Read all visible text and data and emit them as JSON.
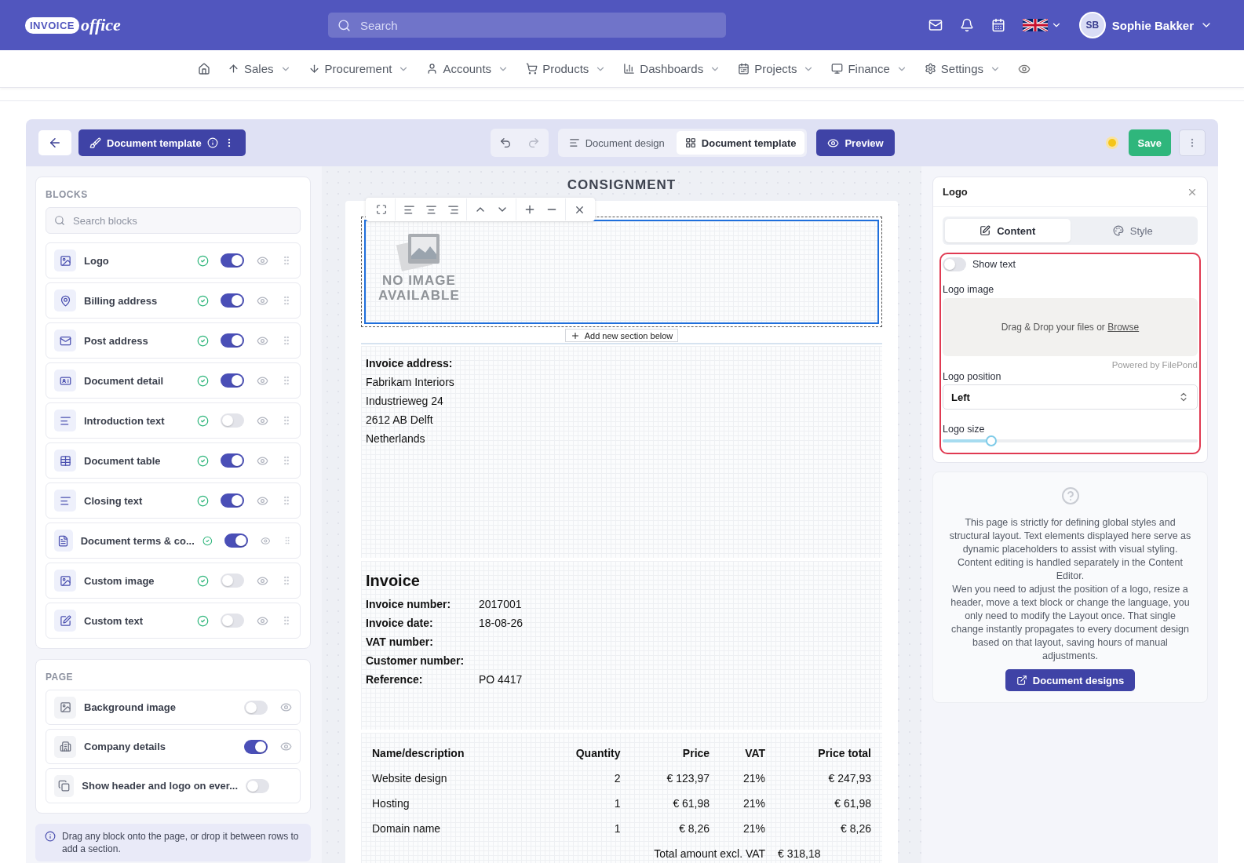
{
  "logo": {
    "word": "INVOICE",
    "script": "office"
  },
  "search": {
    "placeholder": "Search"
  },
  "user": {
    "initials": "SB",
    "name": "Sophie Bakker"
  },
  "nav": [
    {
      "label": "Sales"
    },
    {
      "label": "Procurement"
    },
    {
      "label": "Accounts"
    },
    {
      "label": "Products"
    },
    {
      "label": "Dashboards"
    },
    {
      "label": "Projects"
    },
    {
      "label": "Finance"
    },
    {
      "label": "Settings"
    }
  ],
  "editor_toolbar": {
    "template_button": "Document template",
    "views": [
      {
        "label": "Document design",
        "selected": false
      },
      {
        "label": "Document template",
        "selected": true
      }
    ],
    "preview": "Preview",
    "save": "Save"
  },
  "blocks": {
    "title": "BLOCKS",
    "search_placeholder": "Search blocks",
    "items": [
      {
        "label": "Logo",
        "on": true
      },
      {
        "label": "Billing address",
        "on": true
      },
      {
        "label": "Post address",
        "on": true
      },
      {
        "label": "Document detail",
        "on": true
      },
      {
        "label": "Introduction text",
        "on": false
      },
      {
        "label": "Document table",
        "on": true
      },
      {
        "label": "Closing text",
        "on": true
      },
      {
        "label": "Document terms & co...",
        "on": true
      },
      {
        "label": "Custom image",
        "on": false
      },
      {
        "label": "Custom text",
        "on": false
      }
    ]
  },
  "page": {
    "title": "PAGE",
    "items": [
      {
        "label": "Background image",
        "on": false,
        "eye": true
      },
      {
        "label": "Company details",
        "on": true,
        "eye": true
      },
      {
        "label": "Show header and logo on ever...",
        "on": false,
        "eye": false
      }
    ]
  },
  "hint": "Drag any block onto the page, or drop it between rows to add a section.",
  "document": {
    "title": "CONSIGNMENT",
    "logo_placeholder": [
      "NO IMAGE",
      "AVAILABLE"
    ],
    "add_section": "Add new section below",
    "address_title": "Invoice address:",
    "address": [
      "Fabrikam Interiors",
      "Industrieweg 24",
      "2612 AB Delft",
      "Netherlands"
    ],
    "heading": "Invoice",
    "details": [
      {
        "label": "Invoice number:",
        "value": "2017001"
      },
      {
        "label": "Invoice date:",
        "value": "18-08-26"
      },
      {
        "label": "VAT number:"
      },
      {
        "label": "Customer number:"
      },
      {
        "label": "Reference:",
        "value": "PO 4417"
      }
    ],
    "table": {
      "columns": [
        "Name/description",
        "Quantity",
        "Price",
        "VAT",
        "Price total"
      ],
      "rows": [
        [
          "Website design",
          "2",
          "€ 123,97",
          "21%",
          "€ 247,93"
        ],
        [
          "Hosting",
          "1",
          "€ 61,98",
          "21%",
          "€ 61,98"
        ],
        [
          "Domain name",
          "1",
          "€ 8,26",
          "21%",
          "€ 8,26"
        ]
      ],
      "total_label": "Total amount excl. VAT",
      "total_value": "€ 318,18"
    }
  },
  "inspector": {
    "title": "Logo",
    "tabs": [
      {
        "label": "Content",
        "selected": true
      },
      {
        "label": "Style",
        "selected": false
      }
    ],
    "show_text": {
      "label": "Show text",
      "on": false
    },
    "image_label": "Logo image",
    "drop_text": "Drag & Drop your files or ",
    "browse": "Browse",
    "powered": "Powered by FilePond",
    "position_label": "Logo position",
    "position_value": "Left",
    "size_label": "Logo size",
    "size": {
      "level": 0.19
    }
  },
  "help": {
    "paragraphs": [
      "This page is strictly for defining global styles and structural layout. Text elements displayed here serve as dynamic placeholders to assist with visual styling. Content editing is handled separately in the Content Editor.",
      "Wen you need to adjust the position of a logo, resize a header, move a text block or change the language, you only need to modify the Layout once. That single change instantly propagates to every document design based on that layout, saving hours of manual adjustments."
    ],
    "button": "Document designs"
  }
}
